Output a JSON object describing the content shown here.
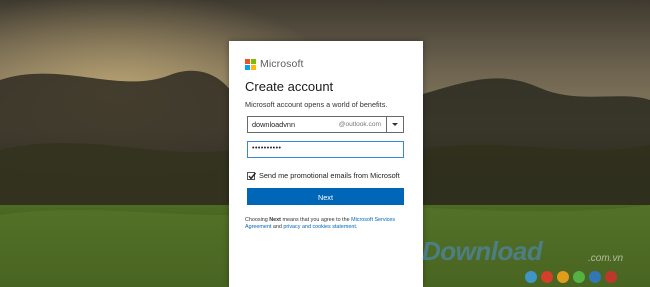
{
  "brand": {
    "name": "Microsoft",
    "logo_colors": [
      "#f25022",
      "#7fba00",
      "#00a4ef",
      "#ffb900"
    ]
  },
  "form": {
    "title": "Create account",
    "subtitle": "Microsoft account opens a world of benefits.",
    "email_value": "downloadvnn",
    "email_domain": "@outlook.com",
    "password_value": "••••••••••",
    "promo_checkbox": {
      "label": "Send me promotional emails from Microsoft",
      "checked": true
    },
    "next_label": "Next",
    "legal": {
      "prefix": "Choosing ",
      "bold": "Next",
      "middle": " means that you agree to the ",
      "link1": "Microsoft Services Agreement",
      "and": " and ",
      "link2": "privacy and cookies statement",
      "end": "."
    }
  },
  "watermark": {
    "text": "Download",
    "suffix": ".com.vn",
    "dot_colors": [
      "#3e9ad8",
      "#e23b2b",
      "#f0a31b",
      "#57b947",
      "#2f79c6",
      "#c9332b"
    ]
  },
  "colors": {
    "accent": "#0067b8",
    "focus_border": "#3a86d8"
  }
}
